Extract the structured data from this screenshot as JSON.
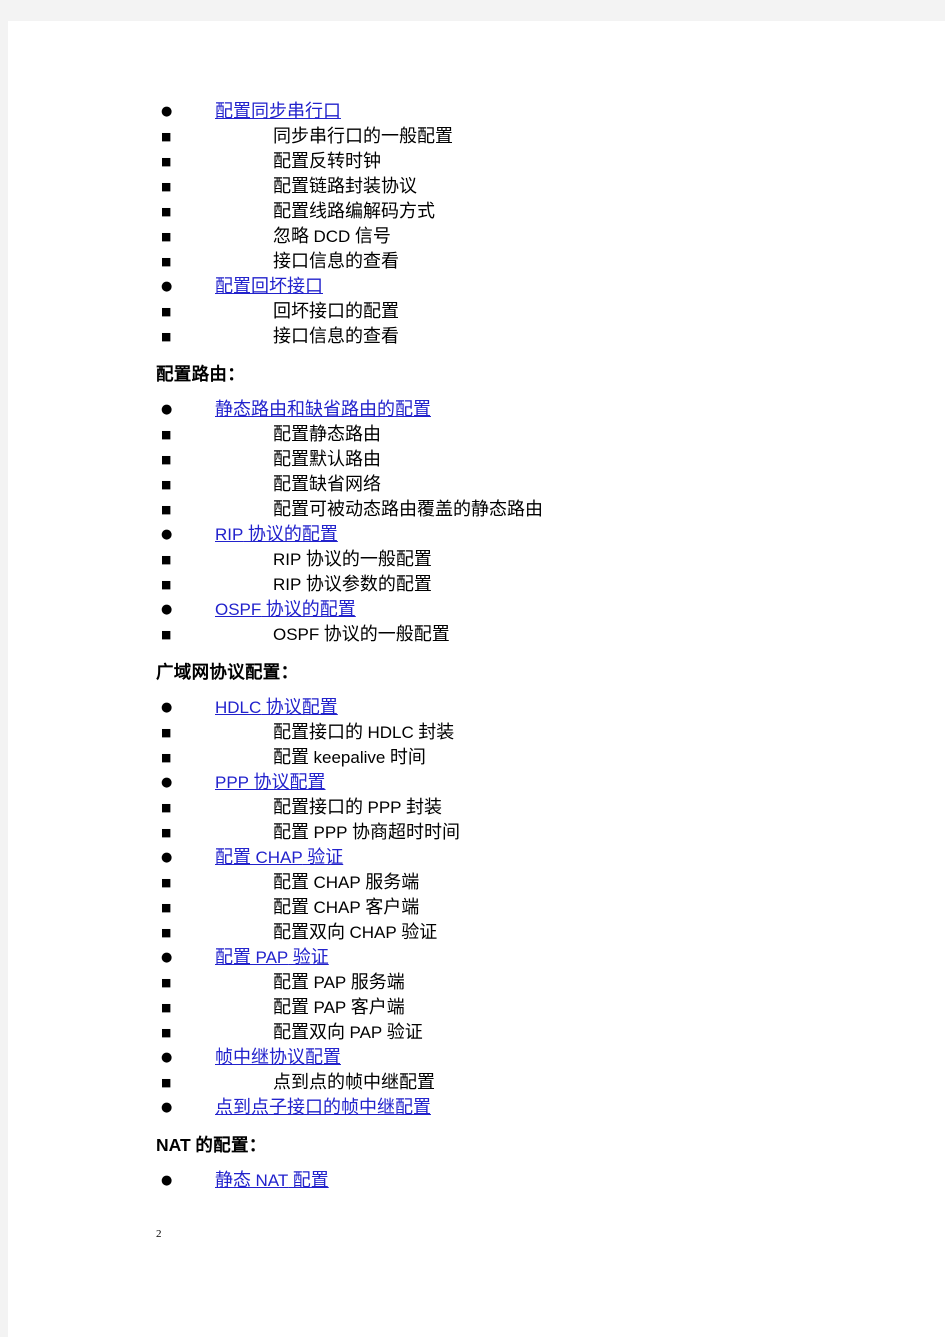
{
  "page": {
    "number": "2",
    "background_color": "#ffffff",
    "gutter_color": "#f3f3f3",
    "link_color": "#2222cc"
  },
  "bullets": {
    "level_1": "●",
    "level_2": "■"
  },
  "sections": [
    {
      "heading": null,
      "items": [
        {
          "level": 1,
          "link": true,
          "text": "配置同步串行口"
        },
        {
          "level": 2,
          "link": false,
          "text": "同步串行口的一般配置"
        },
        {
          "level": 2,
          "link": false,
          "text": "配置反转时钟"
        },
        {
          "level": 2,
          "link": false,
          "text": "配置链路封装协议"
        },
        {
          "level": 2,
          "link": false,
          "text": "配置线路编解码方式"
        },
        {
          "level": 2,
          "link": false,
          "text": "忽略 <span class=\"latin\">DCD</span> 信号"
        },
        {
          "level": 2,
          "link": false,
          "text": "接口信息的查看"
        },
        {
          "level": 1,
          "link": true,
          "text": "配置回坏接口"
        },
        {
          "level": 2,
          "link": false,
          "text": "回坏接口的配置"
        },
        {
          "level": 2,
          "link": false,
          "text": "接口信息的查看"
        }
      ]
    },
    {
      "heading": "配置路由：",
      "items": [
        {
          "level": 1,
          "link": true,
          "text": "静态路由和缺省路由的配置"
        },
        {
          "level": 2,
          "link": false,
          "text": "配置静态路由"
        },
        {
          "level": 2,
          "link": false,
          "text": "配置默认路由"
        },
        {
          "level": 2,
          "link": false,
          "text": "配置缺省网络"
        },
        {
          "level": 2,
          "link": false,
          "text": "配置可被动态路由覆盖的静态路由"
        },
        {
          "level": 1,
          "link": true,
          "text": "<span class=\"latin\">RIP</span> 协议的配置"
        },
        {
          "level": 2,
          "link": false,
          "text": "<span class=\"latin\">RIP</span> 协议的一般配置"
        },
        {
          "level": 2,
          "link": false,
          "text": "<span class=\"latin\">RIP</span> 协议参数的配置"
        },
        {
          "level": 1,
          "link": true,
          "text": "<span class=\"latin\">OSPF</span> 协议的配置"
        },
        {
          "level": 2,
          "link": false,
          "text": "<span class=\"latin\">OSPF</span> 协议的一般配置"
        }
      ]
    },
    {
      "heading": "广域网协议配置：",
      "items": [
        {
          "level": 1,
          "link": true,
          "text": "<span class=\"latin\">HDLC</span> 协议配置"
        },
        {
          "level": 2,
          "link": false,
          "text": "配置接口的 <span class=\"latin\">HDLC</span> 封装"
        },
        {
          "level": 2,
          "link": false,
          "text": "配置 <span class=\"latin\">keepalive</span> 时间"
        },
        {
          "level": 1,
          "link": true,
          "text": "<span class=\"latin\">PPP</span> 协议配置"
        },
        {
          "level": 2,
          "link": false,
          "text": "配置接口的 <span class=\"latin\">PPP</span> 封装"
        },
        {
          "level": 2,
          "link": false,
          "text": "配置 <span class=\"latin\">PPP</span> 协商超时时间"
        },
        {
          "level": 1,
          "link": true,
          "text": "配置 <span class=\"latin\">CHAP</span> 验证"
        },
        {
          "level": 2,
          "link": false,
          "text": "配置 <span class=\"latin\">CHAP</span> 服务端"
        },
        {
          "level": 2,
          "link": false,
          "text": "配置 <span class=\"latin\">CHAP</span> 客户端"
        },
        {
          "level": 2,
          "link": false,
          "text": "配置双向 <span class=\"latin\">CHAP</span> 验证"
        },
        {
          "level": 1,
          "link": true,
          "text": "配置 <span class=\"latin\">PAP</span> 验证"
        },
        {
          "level": 2,
          "link": false,
          "text": "配置 <span class=\"latin\">PAP</span> 服务端"
        },
        {
          "level": 2,
          "link": false,
          "text": "配置 <span class=\"latin\">PAP</span> 客户端"
        },
        {
          "level": 2,
          "link": false,
          "text": "配置双向 <span class=\"latin\">PAP</span> 验证"
        },
        {
          "level": 1,
          "link": true,
          "text": "帧中继协议配置"
        },
        {
          "level": 2,
          "link": false,
          "text": "点到点的帧中继配置"
        },
        {
          "level": 1,
          "link": true,
          "text": "点到点子接口的帧中继配置"
        }
      ]
    },
    {
      "heading": "<span class=\"latin\">NAT</span> 的配置：",
      "items": [
        {
          "level": 1,
          "link": true,
          "text": "静态 <span class=\"latin\">NAT</span> 配置"
        }
      ]
    }
  ]
}
